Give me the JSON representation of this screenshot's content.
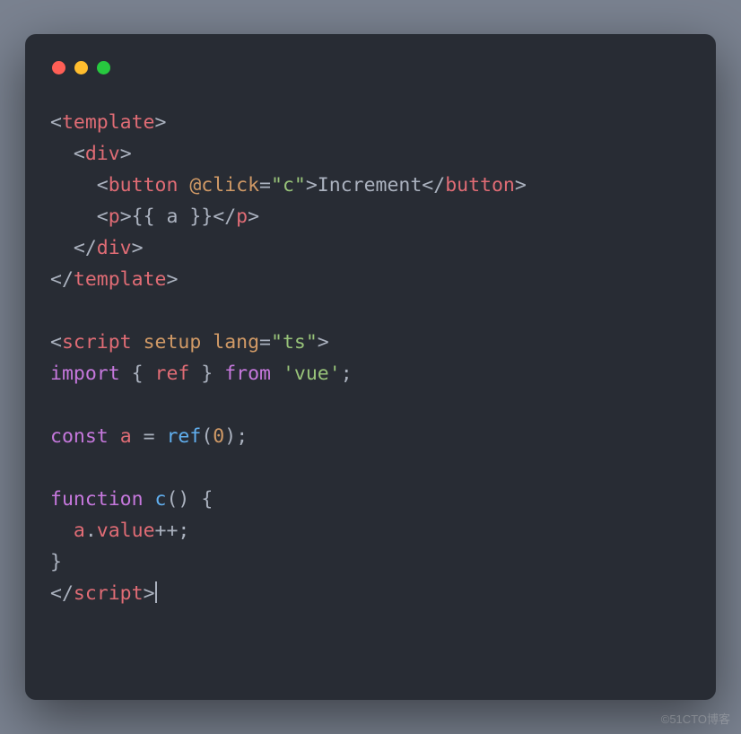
{
  "code": {
    "line1": {
      "open": "<",
      "tag": "template",
      "close": ">"
    },
    "line2": {
      "open": "<",
      "tag": "div",
      "close": ">"
    },
    "line3": {
      "open": "<",
      "tag": "button",
      "attr": "@click",
      "eq": "=",
      "q1": "\"",
      "val": "c",
      "q2": "\"",
      "gt": ">",
      "text": "Increment",
      "open2": "</",
      "tag2": "button",
      "close2": ">"
    },
    "line4": {
      "open": "<",
      "tag": "p",
      "gt": ">",
      "mustache": "{{ a }}",
      "open2": "</",
      "tag2": "p",
      "close2": ">"
    },
    "line5": {
      "open": "</",
      "tag": "div",
      "close": ">"
    },
    "line6": {
      "open": "</",
      "tag": "template",
      "close": ">"
    },
    "line8": {
      "open": "<",
      "tag": "script",
      "attr1": "setup",
      "attr2": "lang",
      "eq": "=",
      "q1": "\"",
      "val": "ts",
      "q2": "\"",
      "close": ">"
    },
    "line9": {
      "kw": "import",
      "br1": " { ",
      "ident": "ref",
      "br2": " } ",
      "from": "from",
      "sp": " ",
      "q1": "'",
      "mod": "vue",
      "q2": "'",
      "semi": ";"
    },
    "line11": {
      "kw": "const",
      "sp": " ",
      "ident": "a",
      "eq": " = ",
      "func": "ref",
      "p1": "(",
      "num": "0",
      "p2": ")",
      "semi": ";"
    },
    "line13": {
      "kw": "function",
      "sp": " ",
      "func": "c",
      "parens": "()",
      "sp2": " ",
      "brace": "{"
    },
    "line14": {
      "ident": "a",
      "dot": ".",
      "prop": "value",
      "op": "++",
      "semi": ";"
    },
    "line15": {
      "brace": "}"
    },
    "line16": {
      "open": "</",
      "tag": "script",
      "close": ">"
    }
  },
  "watermark": "©51CTO博客"
}
